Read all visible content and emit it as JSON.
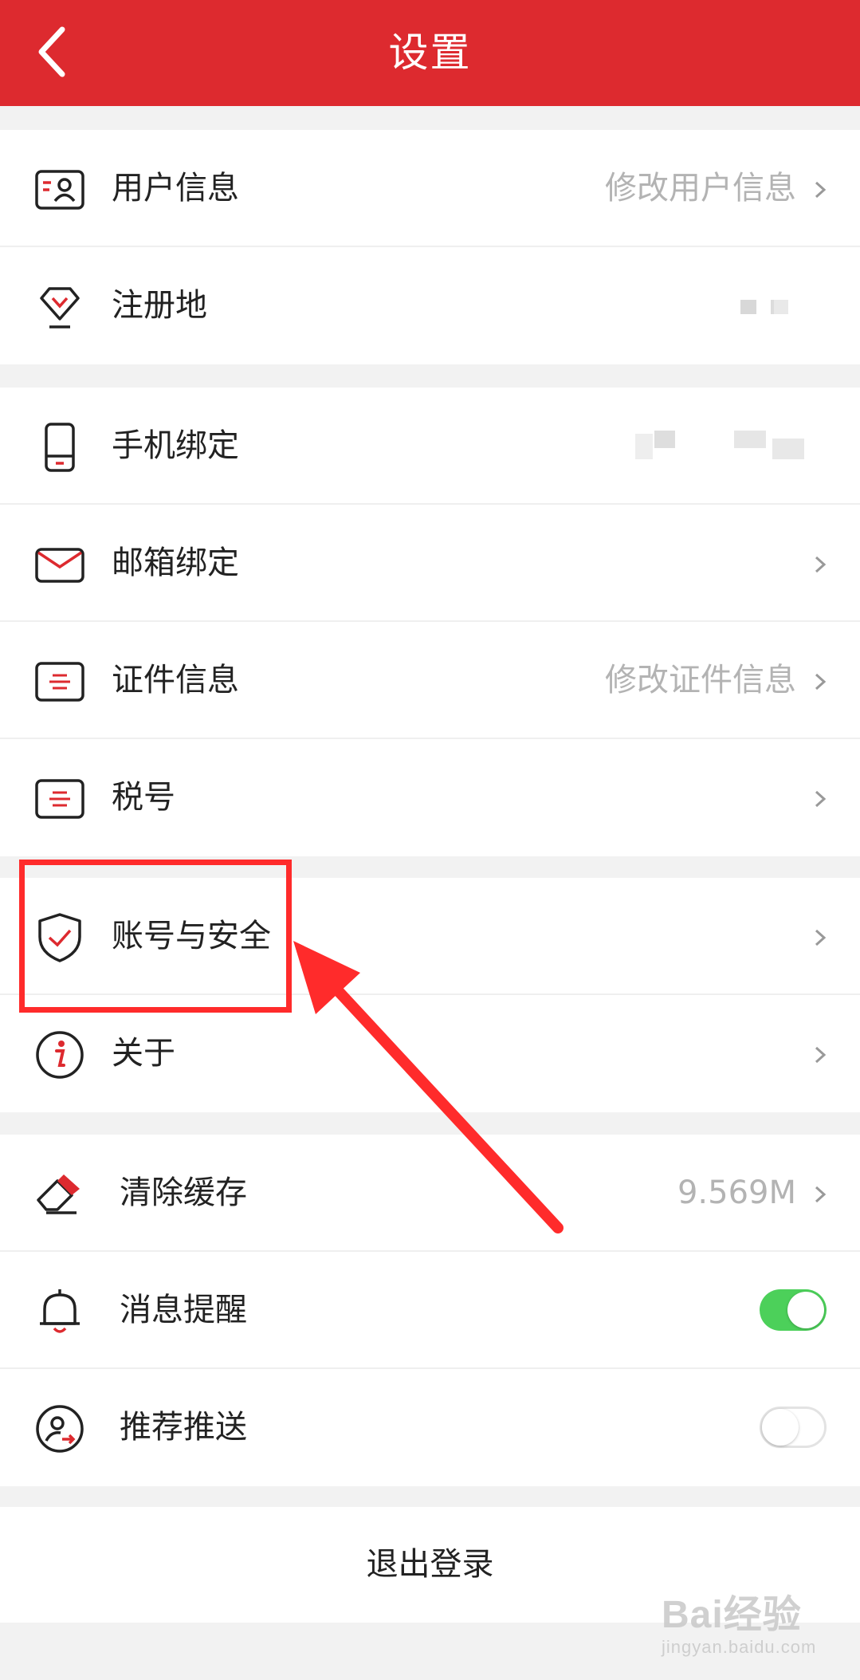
{
  "header": {
    "title": "设置",
    "background": "#dd2a2f"
  },
  "group1": [
    {
      "label": "用户信息",
      "value": "修改用户信息",
      "icon": "user-card-icon"
    },
    {
      "label": "注册地",
      "value": "",
      "icon": "location-diamond-icon"
    }
  ],
  "group2": [
    {
      "label": "手机绑定",
      "value": "",
      "icon": "phone-icon"
    },
    {
      "label": "邮箱绑定",
      "value": "",
      "icon": "mail-icon"
    },
    {
      "label": "证件信息",
      "value": "修改证件信息",
      "icon": "id-doc-icon"
    },
    {
      "label": "税号",
      "value": "",
      "icon": "tax-doc-icon"
    }
  ],
  "group3": [
    {
      "label": "账号与安全",
      "icon": "shield-check-icon"
    },
    {
      "label": "关于",
      "icon": "info-icon"
    }
  ],
  "group4": [
    {
      "label": "清除缓存",
      "value": "9.569M",
      "icon": "eraser-icon"
    },
    {
      "label": "消息提醒",
      "toggle": true,
      "icon": "bell-icon"
    },
    {
      "label": "推荐推送",
      "toggle": false,
      "icon": "user-push-icon"
    }
  ],
  "logout": {
    "label": "退出登录"
  },
  "watermark": {
    "main": "Bai经验",
    "sub": "jingyan.baidu.com"
  },
  "colors": {
    "accent": "#dd2a2f",
    "toggle_on": "#4cd05a",
    "annotation": "#ff2b2b"
  }
}
